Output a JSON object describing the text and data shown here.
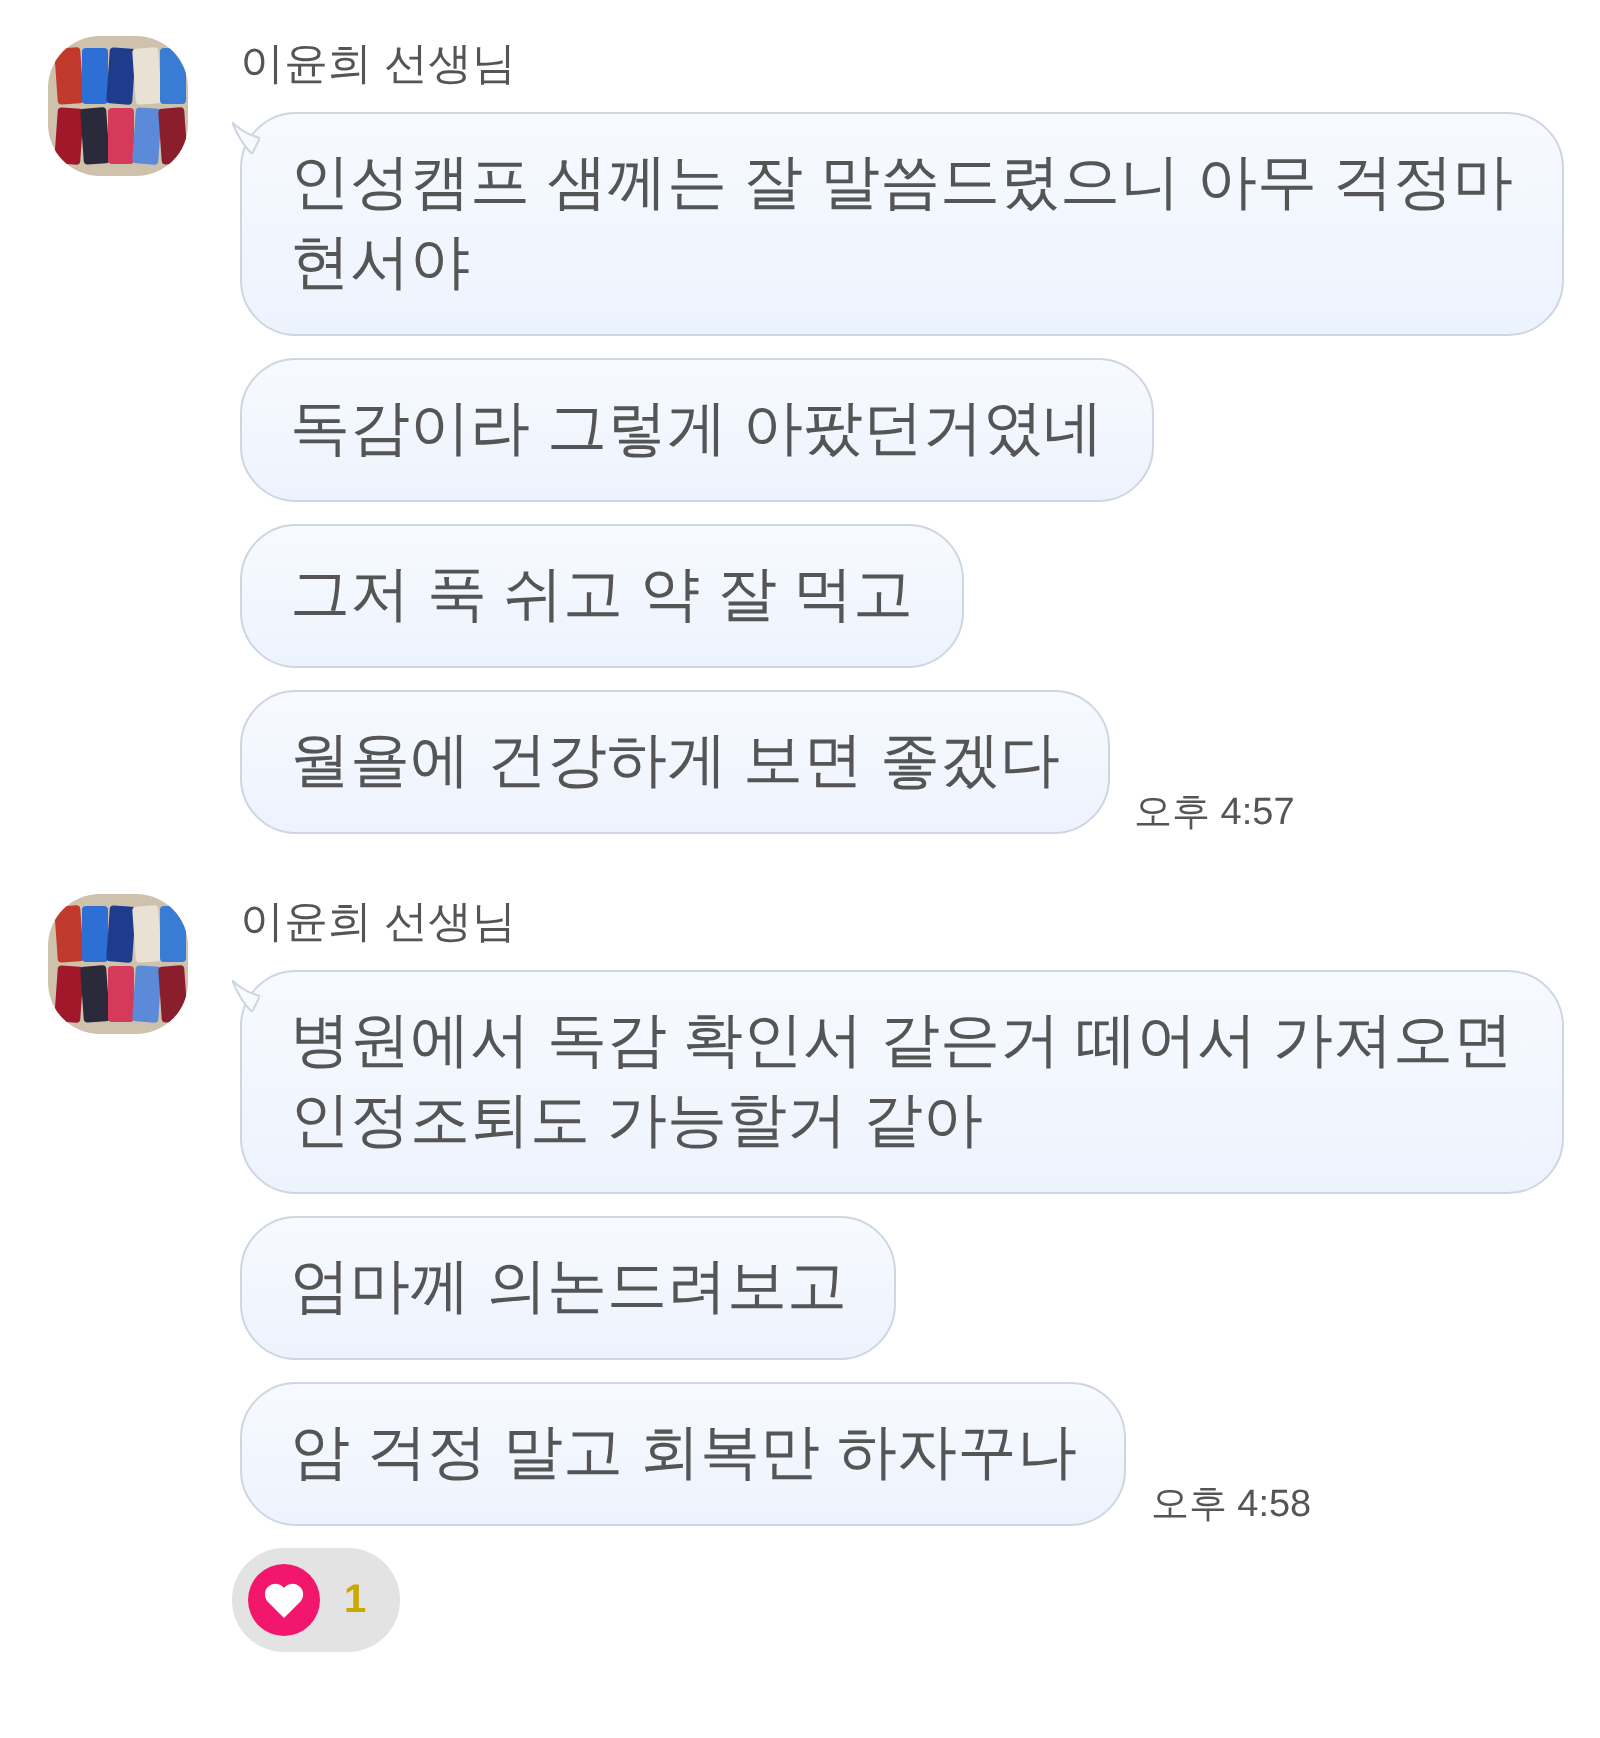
{
  "groups": [
    {
      "sender": "이윤희 선생님",
      "avatar": {
        "kind": "picture"
      },
      "time": "오후 4:57",
      "messages": [
        {
          "lines": [
            "인성캠프 샘께는 잘 말씀드렸으니 아무 걱정마",
            "현서야"
          ]
        },
        {
          "lines": [
            "독감이라 그렇게 아팠던거였네"
          ]
        },
        {
          "lines": [
            "그저 푹 쉬고 약 잘 먹고"
          ]
        },
        {
          "lines": [
            "월욜에 건강하게 보면 좋겠다"
          ]
        }
      ]
    },
    {
      "sender": "이윤희 선생님",
      "avatar": {
        "kind": "picture"
      },
      "time": "오후 4:58",
      "messages": [
        {
          "lines": [
            "병원에서 독감 확인서 같은거 떼어서 가져오면",
            "인정조퇴도 가능할거 같아"
          ]
        },
        {
          "lines": [
            "엄마께 의논드려보고"
          ]
        },
        {
          "lines": [
            "암 걱정 말고 회복만 하자꾸나"
          ]
        }
      ],
      "reaction": {
        "count": "1"
      }
    }
  ]
}
